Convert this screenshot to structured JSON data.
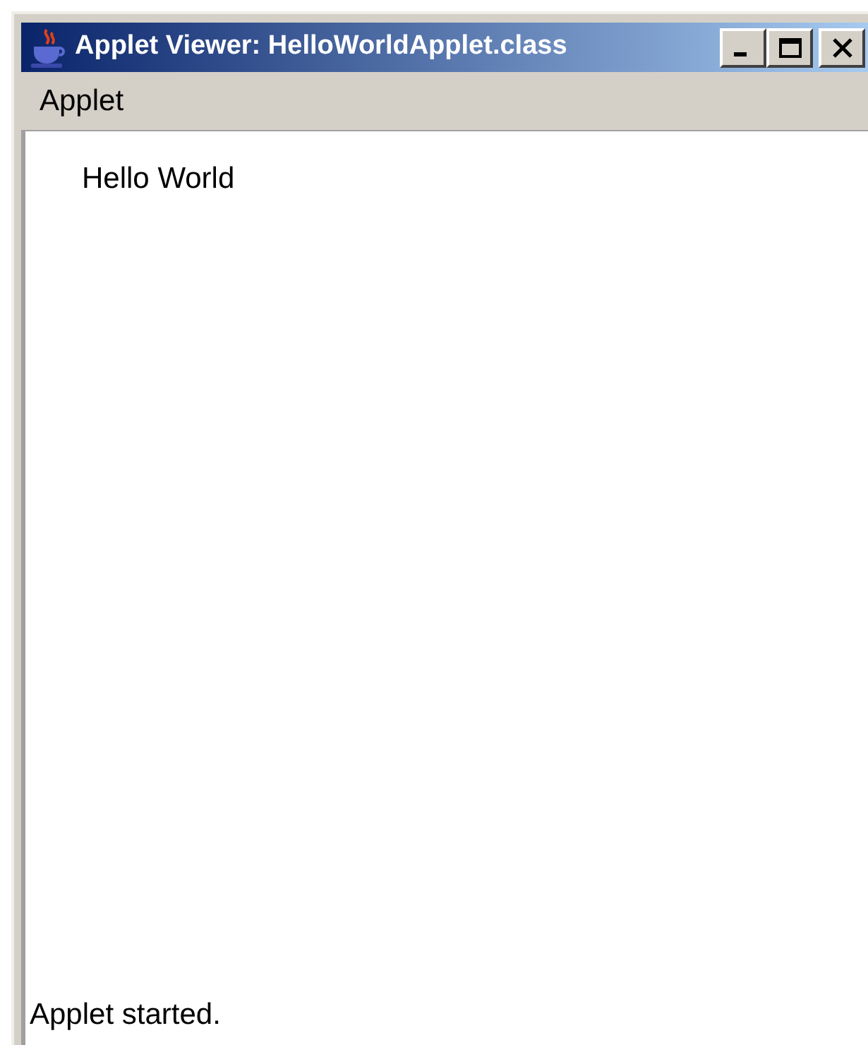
{
  "window": {
    "title": "Applet Viewer: HelloWorldApplet.class"
  },
  "menu_bar": {
    "items": [
      "Applet"
    ]
  },
  "applet": {
    "text": "Hello World"
  },
  "status_bar": "Applet started."
}
